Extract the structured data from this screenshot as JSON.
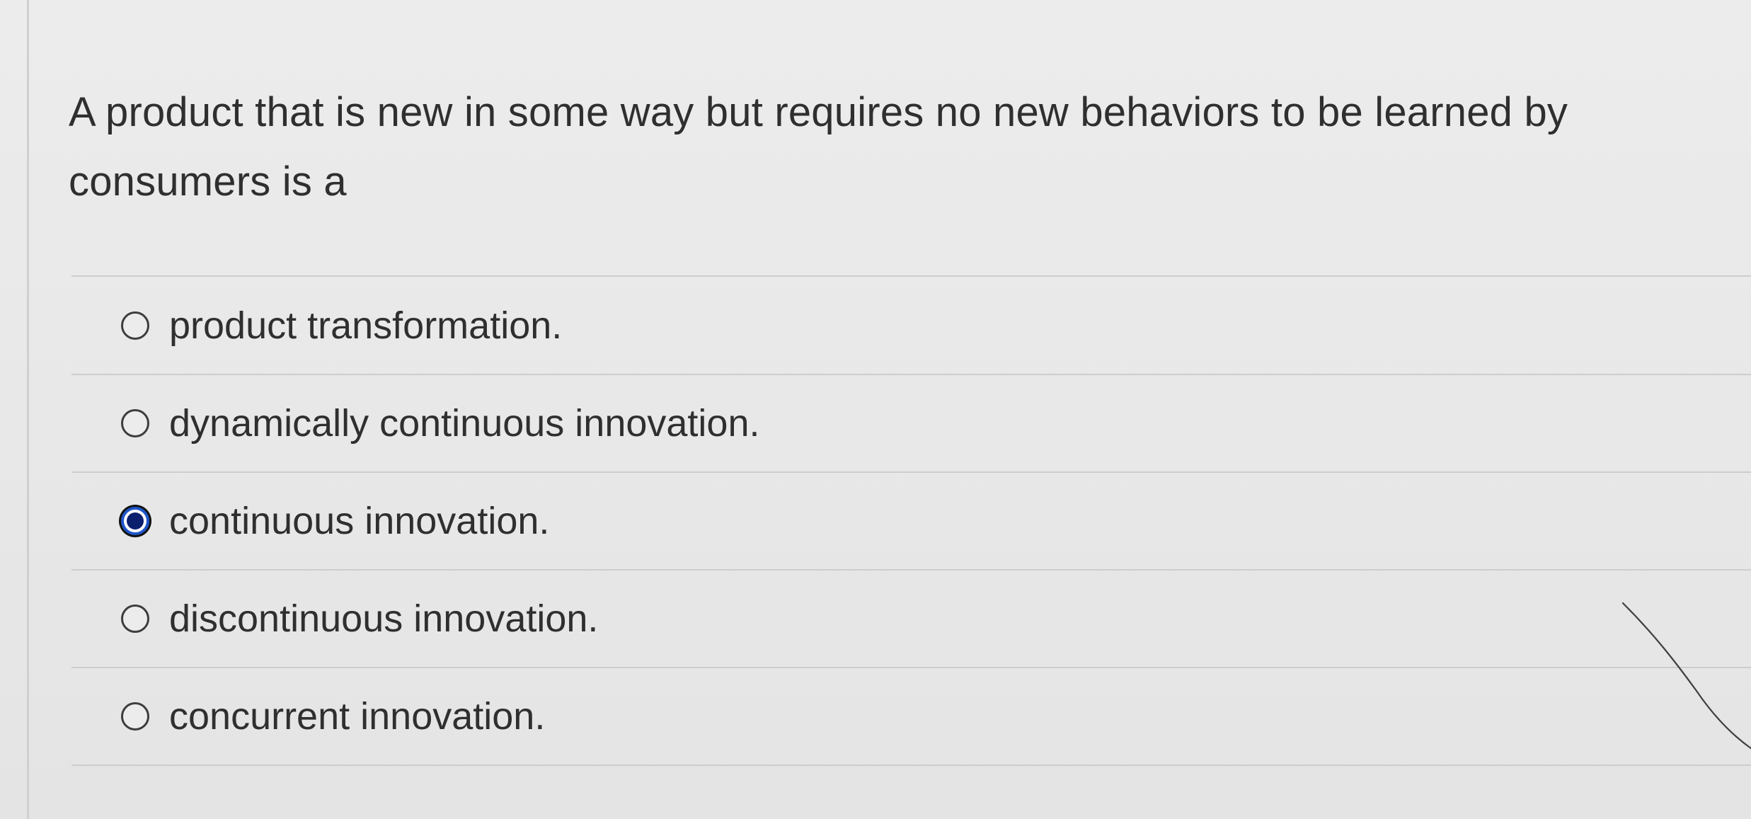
{
  "question": {
    "prompt": "A product that is new in some way but requires no new behaviors to be learned by consumers is a"
  },
  "options": [
    {
      "label": "product transformation.",
      "selected": false
    },
    {
      "label": "dynamically continuous innovation.",
      "selected": false
    },
    {
      "label": "continuous innovation.",
      "selected": true
    },
    {
      "label": "discontinuous innovation.",
      "selected": false
    },
    {
      "label": "concurrent innovation.",
      "selected": false
    }
  ],
  "icons": {
    "radio_unselected": "radio-unselected-icon",
    "radio_selected": "radio-selected-icon"
  },
  "colors": {
    "background": "#e9e9e9",
    "text": "#2f2f2f",
    "divider": "#cdcdcd",
    "selected_radio": "#1f56c9",
    "selected_radio_fill": "#0b1f6f"
  }
}
